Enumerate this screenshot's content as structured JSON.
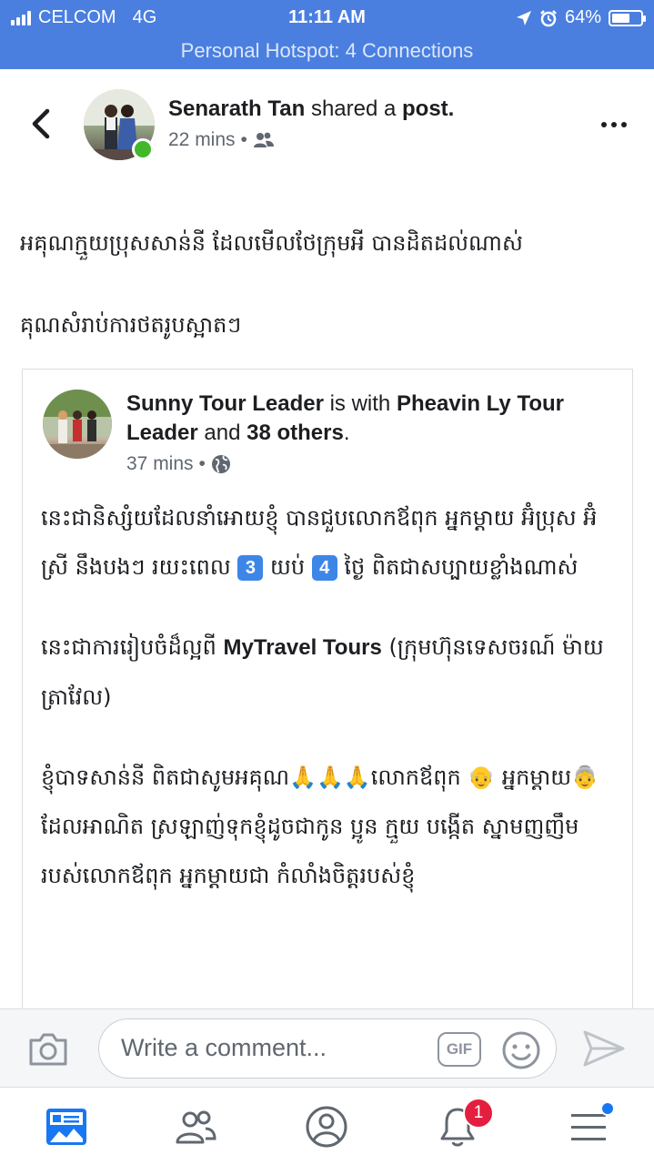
{
  "status_bar": {
    "carrier": "CELCOM",
    "network": "4G",
    "time": "11:11 AM",
    "battery": "64%",
    "battery_level": 0.64,
    "hotspot": "Personal Hotspot: 4 Connections"
  },
  "post": {
    "author": "Senarath Tan",
    "action": "shared a",
    "object": "post.",
    "time": "22 mins",
    "separator": "•",
    "audience_icon": "friends-icon",
    "text_line1": "អគុណក្មួយប្រុសសាន់នី ដែលមើលថែក្រុមអី បានដិតដល់ណាស់",
    "text_line2": "គុណសំរាប់ការថតរូបស្អាតៗ"
  },
  "shared": {
    "author": "Sunny Tour Leader",
    "with_text": "is with",
    "tagged": "Pheavin Ly Tour Leader",
    "and_text": "and",
    "others": "38 others",
    "period": ".",
    "time": "37 mins",
    "separator": "•",
    "audience_icon": "globe-icon",
    "para1_a": "នេះជានិស្សំយដែលនាំអោយខ្ញុំ បានជួបលោកឪពុក អ្នកម្តាយ អ៊ំប្រុស អ៊ំស្រី នឹងបងៗ រយះពេល ",
    "num_nights": "3",
    "para1_b": " យប់ ",
    "num_days": "4",
    "para1_c": " ថ្ងៃ ពិតជាសប្បាយខ្លាំងណាស់",
    "para2_a": "នេះជាការរៀបចំដ៏ល្អពី ",
    "company": "MyTravel Tours",
    "para2_b": " (ក្រុមហ៊ុនទេសចរណ៍ ម៉ាយត្រាវែល)",
    "para3_a": "ខ្ញុំបាទសាន់នី ពិតជាសូមអគុណ",
    "pray": "🙏🙏🙏",
    "para3_b": "លោកឪពុក ",
    "old_man": "👴",
    "para3_c": " អ្នកម្តាយ",
    "old_woman": "👵",
    "para3_d": " ដែលអាណិត ស្រឡាញ់ទុកខ្ញុំដូចជាកូន ប្អូន ក្មួយ បង្កើត ស្នាមញញឹម របស់លោកឪពុក អ្នកម្តាយជា កំលាំងចិត្តរបស់ខ្ញុំ"
  },
  "comment_bar": {
    "placeholder": "Write a comment...",
    "gif_label": "GIF"
  },
  "tab_bar": {
    "items": [
      "news-feed-icon",
      "friends-icon",
      "profile-icon",
      "notifications-icon",
      "menu-icon"
    ],
    "notification_count": "1",
    "accent": "#1877f2"
  },
  "colors": {
    "header_blue": "#4a7fe0",
    "online_green": "#42b72a",
    "badge_red": "#e41e3f"
  }
}
